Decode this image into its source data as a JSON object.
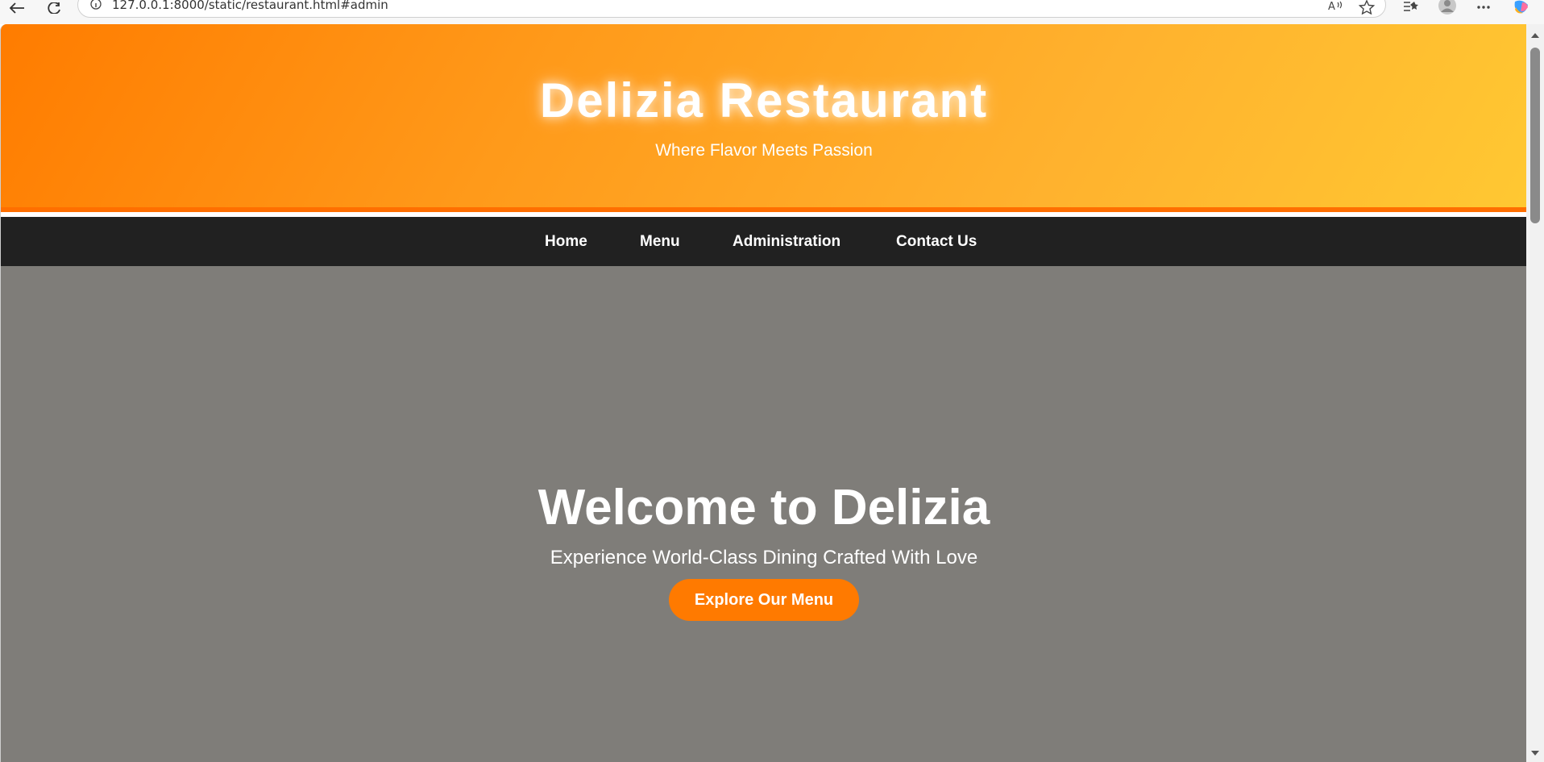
{
  "browser": {
    "url": "127.0.0.1:8000/static/restaurant.html#admin",
    "icons": [
      "back-icon",
      "refresh-icon",
      "info-icon",
      "read-aloud-icon",
      "favorite-star-icon",
      "favorites-list-icon",
      "profile-icon",
      "more-icon",
      "copilot-icon"
    ]
  },
  "header": {
    "title": "Delizia Restaurant",
    "subtitle": "Where Flavor Meets Passion"
  },
  "nav": {
    "items": [
      {
        "label": "Home"
      },
      {
        "label": "Menu"
      },
      {
        "label": "Administration"
      },
      {
        "label": "Contact Us"
      }
    ]
  },
  "hero": {
    "title": "Welcome to Delizia",
    "subtitle": "Experience World-Class Dining Crafted With Love",
    "cta_label": "Explore Our Menu"
  },
  "colors": {
    "header_gradient_start": "#ff7c00",
    "header_gradient_end": "#ffc832",
    "header_border": "#ff6f00",
    "nav_background": "#212121",
    "hero_background": "#7f7d79",
    "cta_background": "#ff7a00",
    "text": "#ffffff"
  }
}
